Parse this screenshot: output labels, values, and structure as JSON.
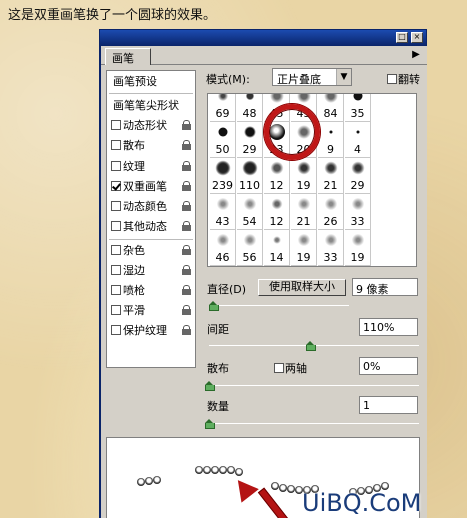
{
  "caption": "这是双重画笔换了一个圆球的效果。",
  "panel": {
    "tab_label": "画笔",
    "title_buttons": [
      "□",
      "×"
    ],
    "menu_arrow": "▶"
  },
  "left_list": {
    "header": "画笔预设",
    "items": [
      {
        "label": "画笔笔尖形状",
        "checkbox": false,
        "locked": false
      },
      {
        "label": "动态形状",
        "checkbox": true,
        "checked": false,
        "locked": true
      },
      {
        "label": "散布",
        "checkbox": true,
        "checked": false,
        "locked": true
      },
      {
        "label": "纹理",
        "checkbox": true,
        "checked": false,
        "locked": true
      },
      {
        "label": "双重画笔",
        "checkbox": true,
        "checked": true,
        "locked": true,
        "selected": true
      },
      {
        "label": "动态颜色",
        "checkbox": true,
        "checked": false,
        "locked": true
      },
      {
        "label": "其他动态",
        "checkbox": true,
        "checked": false,
        "locked": true
      },
      {
        "label": "杂色",
        "checkbox": true,
        "checked": false,
        "locked": true
      },
      {
        "label": "湿边",
        "checkbox": true,
        "checked": false,
        "locked": true
      },
      {
        "label": "喷枪",
        "checkbox": true,
        "checked": false,
        "locked": true
      },
      {
        "label": "平滑",
        "checkbox": true,
        "checked": false,
        "locked": true
      },
      {
        "label": "保护纹理",
        "checkbox": true,
        "checked": false,
        "locked": true
      }
    ]
  },
  "mode": {
    "label": "模式(M):",
    "value": "正片叠底",
    "flip_label": "翻转"
  },
  "brush_grid": {
    "rows": [
      [
        "69",
        "48",
        "45",
        "45",
        "84",
        "35"
      ],
      [
        "50",
        "29",
        "23",
        "20",
        "9",
        "4"
      ],
      [
        "239",
        "110",
        "12",
        "19",
        "21",
        "29"
      ],
      [
        "43",
        "54",
        "12",
        "21",
        "26",
        "33"
      ],
      [
        "46",
        "56",
        "14",
        "19",
        "33",
        "19"
      ]
    ],
    "selected": "23"
  },
  "diameter": {
    "label": "直径(D)",
    "button": "使用取样大小",
    "value": "9 像素",
    "level": 0.03
  },
  "spacing": {
    "label": "间距",
    "value": "110%",
    "level": 0.48
  },
  "scatter": {
    "label": "散布",
    "two_axis_label": "两轴",
    "value": "0%",
    "level": 0
  },
  "count": {
    "label": "数量",
    "value": "1",
    "level": 0
  },
  "watermark": "UiBQ.CoM"
}
